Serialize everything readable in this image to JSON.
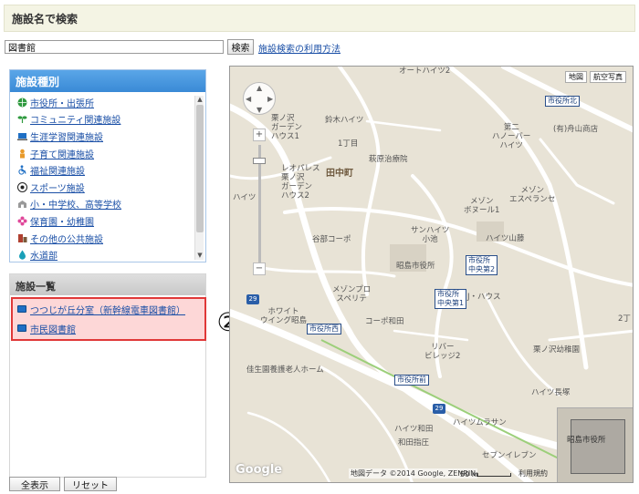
{
  "header": {
    "title": "施設名で検索"
  },
  "search": {
    "value": "図書館",
    "button_label": "検索",
    "help_link": "施設検索の利用方法"
  },
  "categories": {
    "title": "施設種別",
    "items": [
      {
        "label": "市役所・出張所",
        "icon": "globe-icon",
        "color": "#2f9a3f"
      },
      {
        "label": "コミュニティ関連施設",
        "icon": "sprout-icon",
        "color": "#2f9a3f"
      },
      {
        "label": "生涯学習関連施設",
        "icon": "computer-icon",
        "color": "#1f6fc4"
      },
      {
        "label": "子育て関連施設",
        "icon": "child-icon",
        "color": "#e89a2a"
      },
      {
        "label": "福祉関連施設",
        "icon": "wheelchair-icon",
        "color": "#1f6fc4"
      },
      {
        "label": "スポーツ施設",
        "icon": "soccer-ball-icon",
        "color": "#222222"
      },
      {
        "label": "小・中学校、高等学校",
        "icon": "school-icon",
        "color": "#888888"
      },
      {
        "label": "保育園・幼稚園",
        "icon": "flower-icon",
        "color": "#e0489a"
      },
      {
        "label": "その他の公共施設",
        "icon": "building-icon",
        "color": "#b04030"
      },
      {
        "label": "水道部",
        "icon": "water-drop-icon",
        "color": "#1aa0b8"
      }
    ]
  },
  "facility_list": {
    "title": "施設一覧",
    "items": [
      {
        "label": "つつじが丘分室（新幹線電車図書館）"
      },
      {
        "label": "市民図書館"
      }
    ]
  },
  "buttons": {
    "show_all": "全表示",
    "reset": "リセット"
  },
  "annotation": {
    "number": "②"
  },
  "map": {
    "type_buttons": {
      "map": "地図",
      "satellite": "航空写真"
    },
    "town_label": "田中町",
    "labels": [
      {
        "text": "オートハイツ2"
      },
      {
        "text": "栗ノ沢\nガーデン\nハウス1"
      },
      {
        "text": "鈴木ハイツ"
      },
      {
        "text": "1丁目"
      },
      {
        "text": "萩原治療院"
      },
      {
        "text": "レオパレス\n栗ノ沢\nガーデン\nハウス2"
      },
      {
        "text": "ハイツ"
      },
      {
        "text": "第二\nハノーバー\nハイツ"
      },
      {
        "text": "(有)舟山商店"
      },
      {
        "text": "メゾン\nエスペランセ"
      },
      {
        "text": "メゾン\nボヌール1"
      },
      {
        "text": "サンハイツ\n小池"
      },
      {
        "text": "ハイツ山藤"
      },
      {
        "text": "谷部コーポ"
      },
      {
        "text": "昭島市役所"
      },
      {
        "text": "メゾンプロ\nスペリテ"
      },
      {
        "text": "J・ハウス"
      },
      {
        "text": "ホワイト\nウイング昭島"
      },
      {
        "text": "コーポ和田"
      },
      {
        "text": "リバー\nビレッジ2"
      },
      {
        "text": "栗ノ沢幼稚園"
      },
      {
        "text": "佳生園養護老人ホーム"
      },
      {
        "text": "ハイツ長塚"
      },
      {
        "text": "ハイツ和田"
      },
      {
        "text": "ハイツムラサン"
      },
      {
        "text": "和田指圧"
      },
      {
        "text": "セブンイレブン"
      },
      {
        "text": "2丁"
      },
      {
        "text": "昭島"
      }
    ],
    "bus_stops": [
      {
        "text": "市役所北"
      },
      {
        "text": "市役所\n中央第2"
      },
      {
        "text": "市役所\n中央第1"
      },
      {
        "text": "市役所西"
      },
      {
        "text": "市役所前"
      }
    ],
    "route_numbers": [
      "29",
      "29"
    ],
    "zoom": {
      "plus": "+",
      "minus": "−"
    },
    "overview_label": "昭島市役所",
    "logo": "Google",
    "copyright": "地図データ ©2014 Google, ZENRIN",
    "scale": "50 m",
    "terms": "利用規約"
  }
}
